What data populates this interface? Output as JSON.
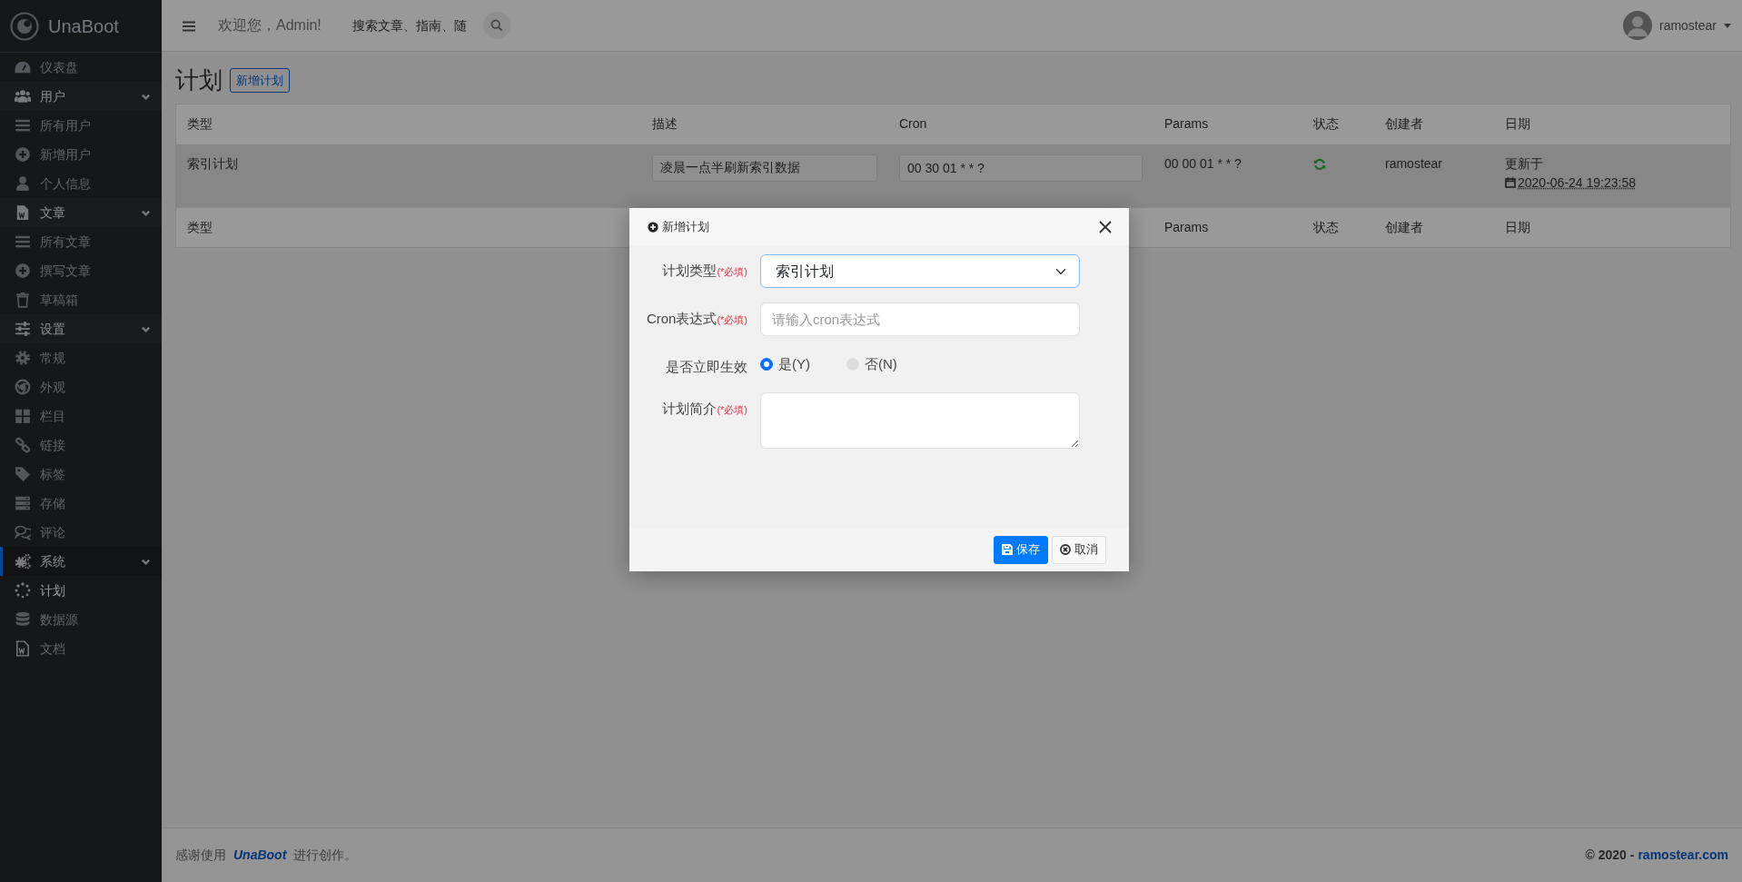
{
  "brand": {
    "name": "UnaBoot"
  },
  "sidebar": {
    "items": [
      {
        "kind": "link",
        "label": "仪表盘",
        "selected": false
      },
      {
        "kind": "group",
        "label": "用户",
        "selected": false,
        "expanded": true,
        "children": [
          {
            "label": "所有用户",
            "selected": false
          },
          {
            "label": "新增用户",
            "selected": false
          },
          {
            "label": "个人信息",
            "selected": false
          }
        ]
      },
      {
        "kind": "group",
        "label": "文章",
        "selected": false,
        "expanded": true,
        "children": [
          {
            "label": "所有文章",
            "selected": false
          },
          {
            "label": "撰写文章",
            "selected": false
          },
          {
            "label": "草稿箱",
            "selected": false
          }
        ]
      },
      {
        "kind": "group",
        "label": "设置",
        "selected": false,
        "expanded": true,
        "children": [
          {
            "label": "常规",
            "selected": false
          },
          {
            "label": "外观",
            "selected": false
          },
          {
            "label": "栏目",
            "selected": false
          },
          {
            "label": "链接",
            "selected": false
          },
          {
            "label": "标签",
            "selected": false
          },
          {
            "label": "存储",
            "selected": false
          },
          {
            "label": "评论",
            "selected": false
          }
        ]
      },
      {
        "kind": "group",
        "label": "系统",
        "selected": true,
        "expanded": true,
        "children": [
          {
            "label": "计划",
            "selected": true
          },
          {
            "label": "数据源",
            "selected": false
          },
          {
            "label": "文档",
            "selected": false
          }
        ]
      }
    ]
  },
  "header": {
    "greeting": "欢迎您，Admin!",
    "search": {
      "placeholder": "搜索文章、指南、随"
    },
    "user": {
      "name": "ramostear"
    }
  },
  "page": {
    "title": "计划",
    "add_button": "新增计划"
  },
  "table": {
    "columns": [
      "类型",
      "描述",
      "Cron",
      "Params",
      "状态",
      "创建者",
      "日期"
    ],
    "rows": [
      {
        "type": "索引计划",
        "description": "凌晨一点半刷新索引数据",
        "cron": "00 30 01 * * ?",
        "params": "00 00 01 * * ?",
        "active": true,
        "creator": "ramostear",
        "date_label": "更新于",
        "date": "2020-06-24 19:23:58"
      }
    ],
    "footer_columns": [
      "类型",
      "Params",
      "状态",
      "创建者",
      "日期"
    ]
  },
  "modal": {
    "title": "新增计划",
    "fields": [
      {
        "kind": "select",
        "label": "计划类型",
        "required": "(*必填)",
        "value": "索引计划"
      },
      {
        "kind": "input",
        "label": "Cron表达式",
        "required": "(*必填)",
        "placeholder": "请输入cron表达式"
      },
      {
        "kind": "radio",
        "label": "是否立即生效",
        "options": [
          {
            "label": "是(Y)",
            "selected": true
          },
          {
            "label": "否(N)",
            "selected": false
          }
        ]
      },
      {
        "kind": "textarea",
        "label": "计划简介",
        "required": "(*必填)"
      }
    ],
    "buttons": [
      {
        "kind": "primary",
        "label": "保存"
      },
      {
        "kind": "secondary",
        "label": "取消"
      }
    ]
  },
  "footer": {
    "prefix": "感谢使用",
    "link": "UnaBoot",
    "suffix": "进行创作。",
    "copyright": "© 2020 -",
    "site": "ramostear.com"
  }
}
